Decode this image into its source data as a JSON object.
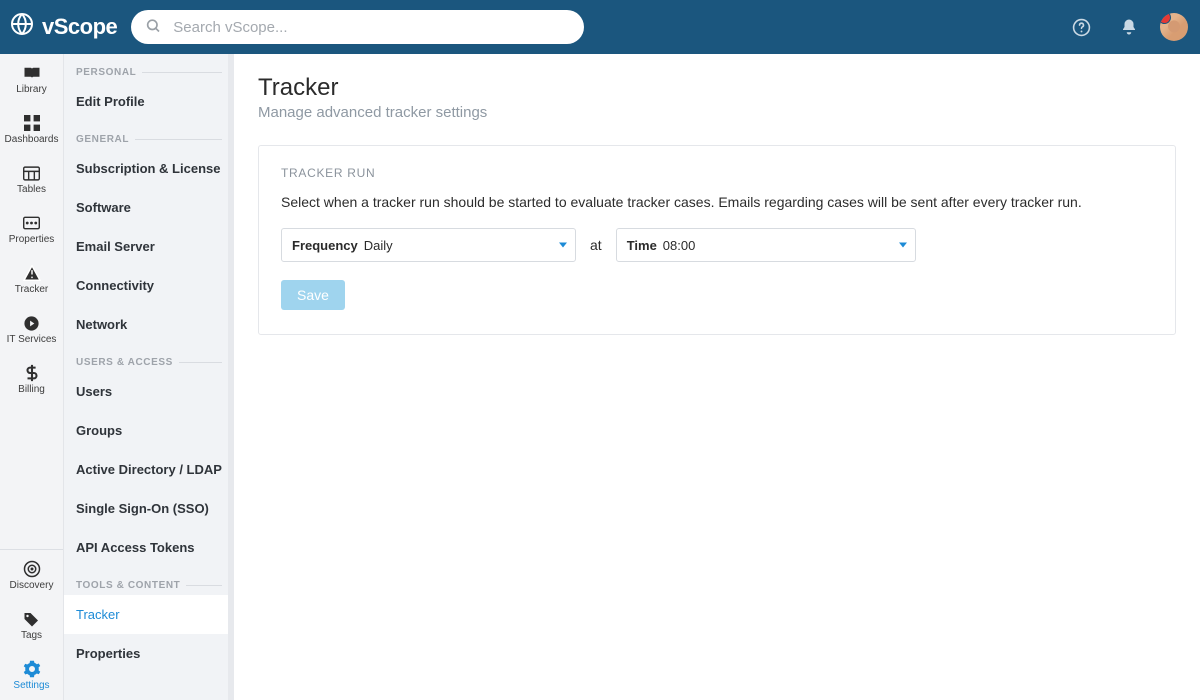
{
  "brand": "vScope",
  "search": {
    "placeholder": "Search vScope..."
  },
  "rail": {
    "top": [
      {
        "id": "library",
        "label": "Library"
      },
      {
        "id": "dashboards",
        "label": "Dashboards"
      },
      {
        "id": "tables",
        "label": "Tables"
      },
      {
        "id": "properties",
        "label": "Properties"
      },
      {
        "id": "tracker",
        "label": "Tracker"
      },
      {
        "id": "itservices",
        "label": "IT Services"
      },
      {
        "id": "billing",
        "label": "Billing"
      }
    ],
    "bottom": [
      {
        "id": "discovery",
        "label": "Discovery"
      },
      {
        "id": "tags",
        "label": "Tags"
      },
      {
        "id": "settings",
        "label": "Settings",
        "active": true
      }
    ]
  },
  "settings_sidebar": {
    "sections": [
      {
        "heading": "PERSONAL",
        "items": [
          "Edit Profile"
        ]
      },
      {
        "heading": "GENERAL",
        "items": [
          "Subscription & License",
          "Software",
          "Email Server",
          "Connectivity",
          "Network"
        ]
      },
      {
        "heading": "USERS & ACCESS",
        "items": [
          "Users",
          "Groups",
          "Active Directory / LDAP",
          "Single Sign-On (SSO)",
          "API Access Tokens"
        ]
      },
      {
        "heading": "TOOLS & CONTENT",
        "items": [
          "Tracker",
          "Properties"
        ],
        "active_index": 0
      }
    ]
  },
  "page": {
    "title": "Tracker",
    "subtitle": "Manage advanced tracker settings"
  },
  "tracker_run": {
    "heading": "TRACKER RUN",
    "description": "Select when a tracker run should be started to evaluate tracker cases. Emails regarding cases will be sent after every tracker run.",
    "frequency_label": "Frequency",
    "frequency_value": "Daily",
    "at_label": "at",
    "time_label": "Time",
    "time_value": "08:00",
    "save_label": "Save"
  }
}
